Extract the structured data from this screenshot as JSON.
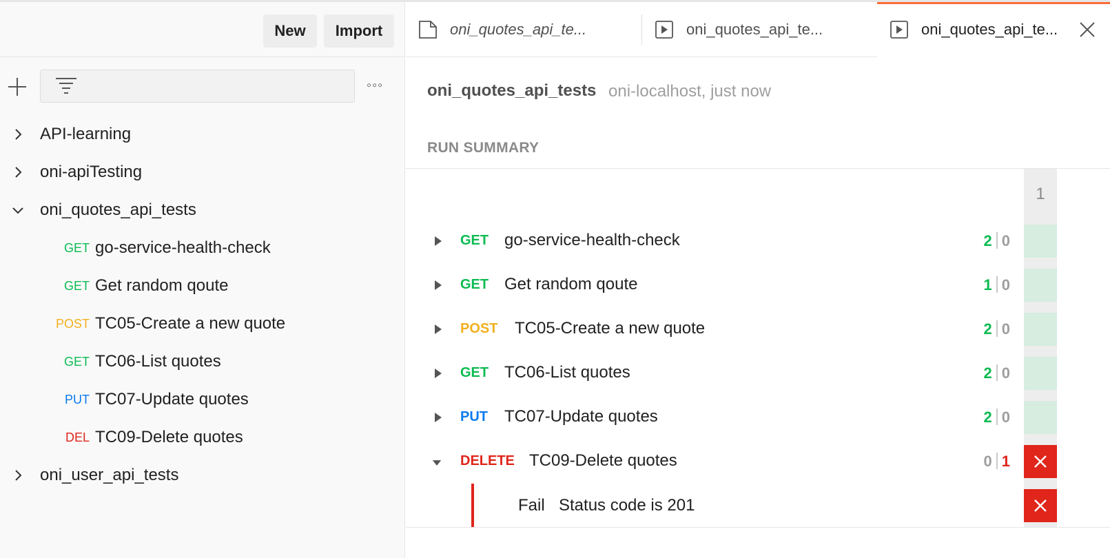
{
  "colors": {
    "get": "#0cbb52",
    "post": "#f2b01e",
    "put": "#097bed",
    "delete": "#e0251b",
    "accent": "#ff6c37",
    "pass_count": "#0cbb52",
    "fail_count": "#e0251b",
    "muted": "#9e9e9e"
  },
  "sidebar": {
    "new_label": "New",
    "import_label": "Import",
    "collections": [
      {
        "name": "API-learning",
        "expanded": false
      },
      {
        "name": "oni-apiTesting",
        "expanded": false
      },
      {
        "name": "oni_quotes_api_tests",
        "expanded": true
      },
      {
        "name": "oni_user_api_tests",
        "expanded": false
      }
    ],
    "requests": [
      {
        "method": "GET",
        "name": "go-service-health-check"
      },
      {
        "method": "GET",
        "name": "Get random qoute"
      },
      {
        "method": "POST",
        "name": "TC05-Create a new quote"
      },
      {
        "method": "GET",
        "name": "TC06-List quotes"
      },
      {
        "method": "PUT",
        "name": "TC07-Update quotes"
      },
      {
        "method": "DEL",
        "name": "TC09-Delete quotes"
      }
    ]
  },
  "tabs": [
    {
      "label": "oni_quotes_api_te...",
      "icon": "collection-icon",
      "italic": true,
      "active": false
    },
    {
      "label": "oni_quotes_api_te...",
      "icon": "runner-icon",
      "italic": false,
      "active": false
    },
    {
      "label": "oni_quotes_api_te...",
      "icon": "runner-icon",
      "italic": false,
      "active": true
    }
  ],
  "run": {
    "title": "oni_quotes_api_tests",
    "subtitle": "oni-localhost, just now",
    "summary_heading": "RUN SUMMARY",
    "iteration_label": "1",
    "requests": [
      {
        "method": "GET",
        "name": "go-service-health-check",
        "pass": "2",
        "fail": "0",
        "status": "pass",
        "expanded": false
      },
      {
        "method": "GET",
        "name": "Get random qoute",
        "pass": "1",
        "fail": "0",
        "status": "pass",
        "expanded": false
      },
      {
        "method": "POST",
        "name": "TC05-Create a new quote",
        "pass": "2",
        "fail": "0",
        "status": "pass",
        "expanded": false
      },
      {
        "method": "GET",
        "name": "TC06-List quotes",
        "pass": "2",
        "fail": "0",
        "status": "pass",
        "expanded": false
      },
      {
        "method": "PUT",
        "name": "TC07-Update quotes",
        "pass": "2",
        "fail": "0",
        "status": "pass",
        "expanded": false
      },
      {
        "method": "DELETE",
        "name": "TC09-Delete quotes",
        "pass": "0",
        "fail": "1",
        "status": "fail",
        "expanded": true
      }
    ],
    "assertion": {
      "result": "Fail",
      "text": "Status code is 201"
    }
  }
}
